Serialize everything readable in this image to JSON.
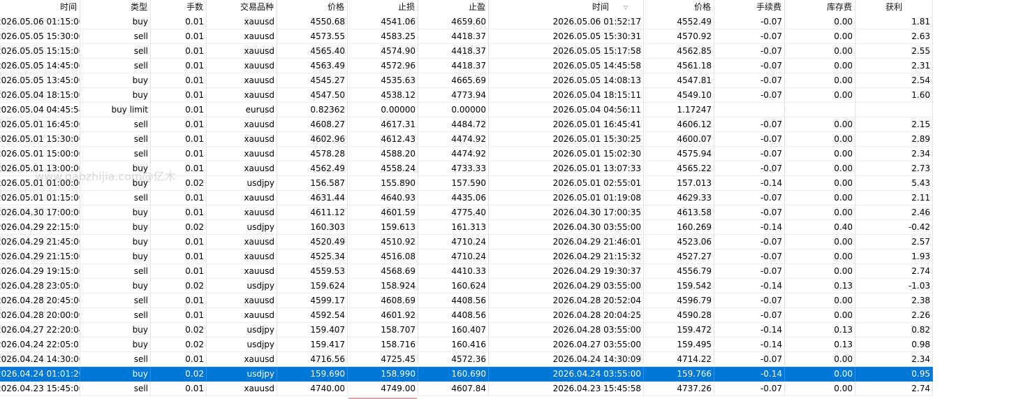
{
  "columns": [
    "时间",
    "类型",
    "手数",
    "交易品种",
    "价格",
    "止损",
    "止盈",
    "时间",
    "价格",
    "手续费",
    "库存费",
    "获利"
  ],
  "sort_indicator": "▽",
  "watermark": "www.gaozhijia.com@亿木",
  "selected_row": 25,
  "rows": [
    [
      "2026.05.06 01:15:00",
      "buy",
      "0.01",
      "xauusd",
      "4550.68",
      "4541.06",
      "4659.60",
      "2026.05.06 01:52:17",
      "4552.49",
      "-0.07",
      "0.00",
      "1.81"
    ],
    [
      "2026.05.05 15:30:00",
      "sell",
      "0.01",
      "xauusd",
      "4573.55",
      "4583.25",
      "4418.37",
      "2026.05.05 15:30:31",
      "4570.92",
      "-0.07",
      "0.00",
      "2.63"
    ],
    [
      "2026.05.05 15:15:00",
      "sell",
      "0.01",
      "xauusd",
      "4565.40",
      "4574.90",
      "4418.37",
      "2026.05.05 15:17:58",
      "4562.85",
      "-0.07",
      "0.00",
      "2.55"
    ],
    [
      "2026.05.05 14:45:00",
      "sell",
      "0.01",
      "xauusd",
      "4563.49",
      "4572.96",
      "4418.37",
      "2026.05.05 14:45:58",
      "4561.18",
      "-0.07",
      "0.00",
      "2.31"
    ],
    [
      "2026.05.05 13:45:00",
      "buy",
      "0.01",
      "xauusd",
      "4545.27",
      "4535.63",
      "4665.69",
      "2026.05.05 14:08:13",
      "4547.81",
      "-0.07",
      "0.00",
      "2.54"
    ],
    [
      "2026.05.04 18:15:00",
      "buy",
      "0.01",
      "xauusd",
      "4547.50",
      "4538.12",
      "4773.94",
      "2026.05.04 18:15:11",
      "4549.10",
      "-0.07",
      "0.00",
      "1.60"
    ],
    [
      "2026.05.04 04:45:54",
      "buy limit",
      "0.01",
      "eurusd",
      "0.82362",
      "0.00000",
      "0.00000",
      "2026.05.04 04:56:11",
      "1.17247",
      "",
      "",
      ""
    ],
    [
      "2026.05.01 16:45:00",
      "sell",
      "0.01",
      "xauusd",
      "4608.27",
      "4617.31",
      "4484.72",
      "2026.05.01 16:45:41",
      "4606.12",
      "-0.07",
      "0.00",
      "2.15"
    ],
    [
      "2026.05.01 15:30:00",
      "sell",
      "0.01",
      "xauusd",
      "4602.96",
      "4612.43",
      "4474.92",
      "2026.05.01 15:30:25",
      "4600.07",
      "-0.07",
      "0.00",
      "2.89"
    ],
    [
      "2026.05.01 15:00:00",
      "sell",
      "0.01",
      "xauusd",
      "4578.28",
      "4588.20",
      "4474.92",
      "2026.05.01 15:02:30",
      "4575.94",
      "-0.07",
      "0.00",
      "2.34"
    ],
    [
      "2026.05.01 13:00:00",
      "buy",
      "0.01",
      "xauusd",
      "4562.49",
      "4558.24",
      "4733.33",
      "2026.05.01 13:07:33",
      "4565.22",
      "-0.07",
      "0.00",
      "2.73"
    ],
    [
      "2026.05.01 01:00:00",
      "buy",
      "0.02",
      "usdjpy",
      "156.587",
      "155.890",
      "157.590",
      "2026.05.01 02:55:01",
      "157.013",
      "-0.14",
      "0.00",
      "5.43"
    ],
    [
      "2026.05.01 01:15:00",
      "sell",
      "0.01",
      "xauusd",
      "4631.44",
      "4640.93",
      "4435.06",
      "2026.05.01 01:19:08",
      "4629.33",
      "-0.07",
      "0.00",
      "2.11"
    ],
    [
      "2026.04.30 17:00:00",
      "buy",
      "0.01",
      "xauusd",
      "4611.12",
      "4601.59",
      "4775.40",
      "2026.04.30 17:00:35",
      "4613.58",
      "-0.07",
      "0.00",
      "2.46"
    ],
    [
      "2026.04.29 22:15:00",
      "buy",
      "0.02",
      "usdjpy",
      "160.303",
      "159.613",
      "161.313",
      "2026.04.30 03:55:00",
      "160.269",
      "-0.14",
      "0.40",
      "-0.42"
    ],
    [
      "2026.04.29 21:45:00",
      "buy",
      "0.01",
      "xauusd",
      "4520.49",
      "4510.92",
      "4710.24",
      "2026.04.29 21:46:01",
      "4523.06",
      "-0.07",
      "0.00",
      "2.57"
    ],
    [
      "2026.04.29 21:15:00",
      "buy",
      "0.01",
      "xauusd",
      "4525.34",
      "4516.08",
      "4710.24",
      "2026.04.29 21:15:32",
      "4527.27",
      "-0.07",
      "0.00",
      "1.93"
    ],
    [
      "2026.04.29 19:15:00",
      "sell",
      "0.01",
      "xauusd",
      "4559.53",
      "4568.69",
      "4410.33",
      "2026.04.29 19:30:37",
      "4556.79",
      "-0.07",
      "0.00",
      "2.74"
    ],
    [
      "2026.04.28 23:05:00",
      "buy",
      "0.02",
      "usdjpy",
      "159.624",
      "158.924",
      "160.624",
      "2026.04.29 03:55:00",
      "159.542",
      "-0.14",
      "0.13",
      "-1.03"
    ],
    [
      "2026.04.28 20:45:00",
      "sell",
      "0.01",
      "xauusd",
      "4599.17",
      "4608.69",
      "4408.56",
      "2026.04.28 20:52:04",
      "4596.79",
      "-0.07",
      "0.00",
      "2.38"
    ],
    [
      "2026.04.28 20:00:00",
      "sell",
      "0.01",
      "xauusd",
      "4592.54",
      "4601.92",
      "4408.56",
      "2026.04.28 20:04:25",
      "4590.28",
      "-0.07",
      "0.00",
      "2.26"
    ],
    [
      "2026.04.27 22:20:04",
      "buy",
      "0.02",
      "usdjpy",
      "159.407",
      "158.707",
      "160.407",
      "2026.04.28 03:55:00",
      "159.472",
      "-0.14",
      "0.13",
      "0.82"
    ],
    [
      "2026.04.24 22:05:02",
      "buy",
      "0.02",
      "usdjpy",
      "159.417",
      "158.716",
      "160.416",
      "2026.04.27 03:55:00",
      "159.495",
      "-0.14",
      "0.13",
      "0.98"
    ],
    [
      "2026.04.24 14:30:00",
      "sell",
      "0.01",
      "xauusd",
      "4716.56",
      "4725.45",
      "4572.36",
      "2026.04.24 14:30:09",
      "4714.22",
      "-0.07",
      "0.00",
      "2.34"
    ],
    [
      "2026.04.24 01:01:20",
      "buy",
      "0.02",
      "usdjpy",
      "159.690",
      "158.990",
      "160.690",
      "2026.04.24 03:55:00",
      "159.766",
      "-0.14",
      "0.00",
      "0.95"
    ],
    [
      "2026.04.23 15:45:00",
      "sell",
      "0.01",
      "xauusd",
      "4740.00",
      "4749.00",
      "4607.84",
      "2026.04.23 15:45:58",
      "4737.26",
      "-0.07",
      "0.00",
      "2.74"
    ]
  ]
}
